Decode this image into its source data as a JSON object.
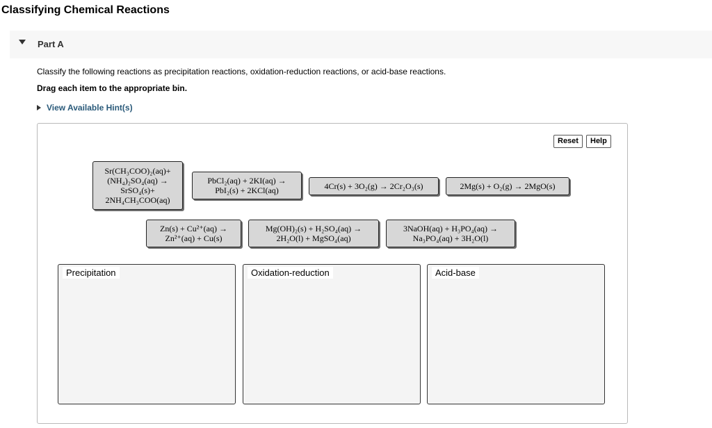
{
  "page": {
    "title": "Classifying Chemical Reactions"
  },
  "part": {
    "label": "Part A"
  },
  "instructions": {
    "text": "Classify the following reactions as precipitation reactions, oxidation-reduction reactions, or acid-base reactions.",
    "drag": "Drag each item to the appropriate bin.",
    "hints": "View Available Hint(s)"
  },
  "buttons": {
    "reset": "Reset",
    "help": "Help"
  },
  "items": [
    {
      "lines": [
        "Sr(CH₃COO)₂(aq)+",
        "(NH₄)₂SO₄(aq) →",
        "SrSO₄(s)+",
        "2NH₄CH₃COO(aq)"
      ]
    },
    {
      "lines": [
        "PbCl₂(aq) + 2KI(aq) →",
        "PbI₂(s) + 2KCl(aq)"
      ]
    },
    {
      "lines": [
        "4Cr(s) + 3O₂(g) → 2Cr₂O₃(s)"
      ]
    },
    {
      "lines": [
        "2Mg(s) + O₂(g) → 2MgO(s)"
      ]
    },
    {
      "lines": [
        "Zn(s) + Cu²⁺(aq) →",
        "Zn²⁺(aq) + Cu(s)"
      ]
    },
    {
      "lines": [
        "Mg(OH)₂(s) + H₂SO₄(aq) →",
        "2H₂O(l) + MgSO₄(aq)"
      ]
    },
    {
      "lines": [
        "3NaOH(aq) + H₃PO₄(aq) →",
        "Na₃PO₄(aq) + 3H₂O(l)"
      ]
    }
  ],
  "bins": [
    {
      "label": "Precipitation"
    },
    {
      "label": "Oxidation-reduction"
    },
    {
      "label": "Acid-base"
    }
  ]
}
